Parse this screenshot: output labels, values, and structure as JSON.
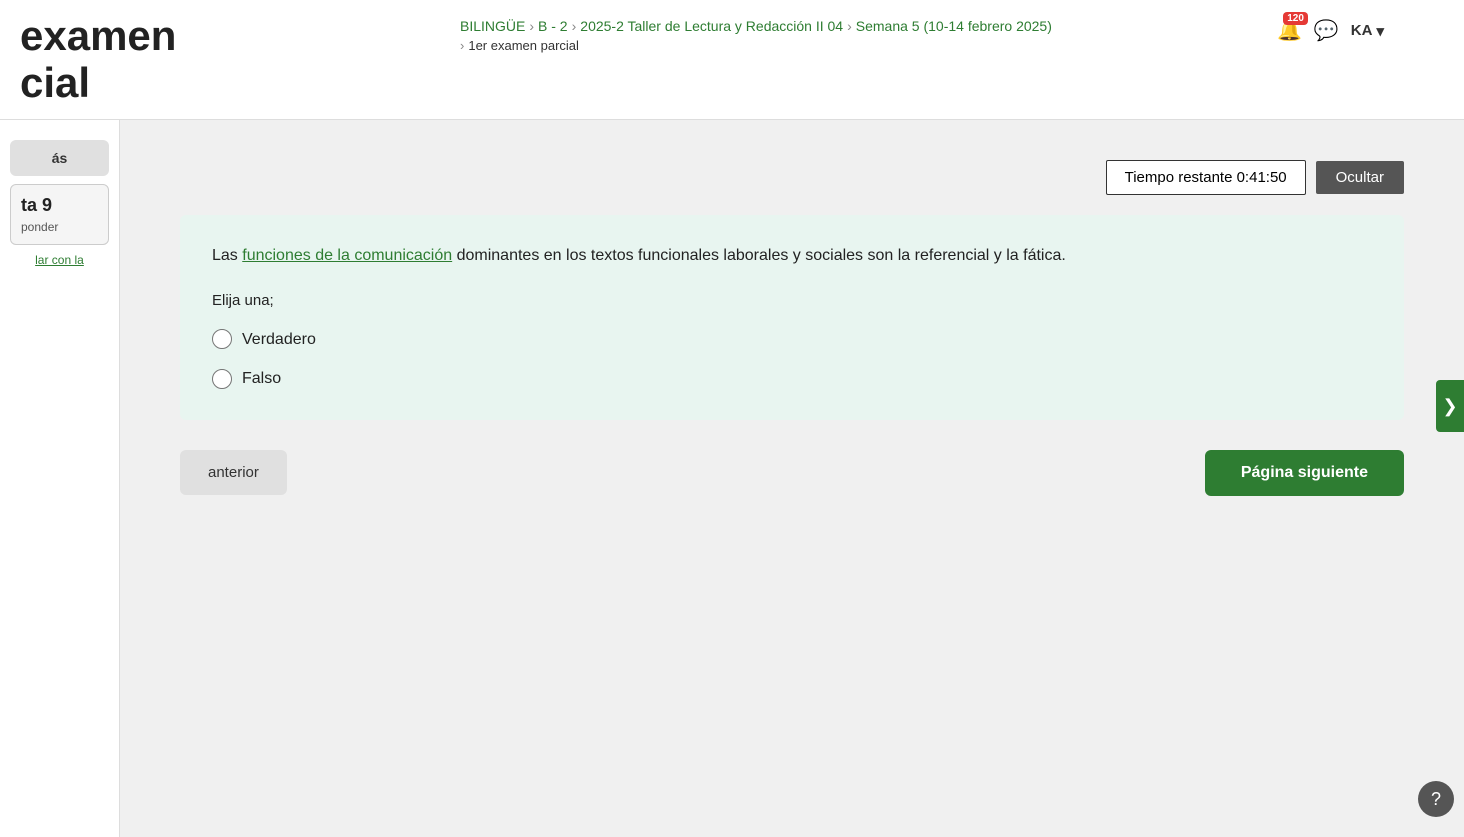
{
  "header": {
    "title_line1": "examen",
    "title_line2": "cial",
    "breadcrumb": {
      "items": [
        {
          "label": "BILINGÜE",
          "type": "link"
        },
        {
          "label": "B - 2",
          "type": "link"
        },
        {
          "label": "2025-2 Taller de Lectura y Redacción II 04",
          "type": "link"
        },
        {
          "label": "Semana 5 (10-14 febrero 2025)",
          "type": "link"
        },
        {
          "label": "1er examen parcial",
          "type": "current"
        }
      ]
    },
    "notif_count": "120",
    "user_label": "KA",
    "chevron": "▾"
  },
  "sidebar": {
    "back_label": "ás",
    "question_label": "ta 9",
    "question_sub": "ponder",
    "flag_text": "lar con la"
  },
  "timer": {
    "label": "Tiempo restante 0:41:50",
    "hide_label": "Ocultar"
  },
  "question": {
    "text_before_link": "Las ",
    "link_text": "funciones de la comunicación",
    "text_after_link": " dominantes en los textos funcionales laborales y sociales son la referencial y la fática.",
    "choose_label": "Elija una;",
    "options": [
      {
        "id": "opt_verdadero",
        "label": "Verdadero"
      },
      {
        "id": "opt_falso",
        "label": "Falso"
      }
    ]
  },
  "navigation": {
    "prev_label": "anterior",
    "next_label": "Página siguiente"
  },
  "icons": {
    "bell": "🔔",
    "chat": "💬",
    "chevron_left": "❮",
    "chevron_right": "❯",
    "help": "?"
  }
}
